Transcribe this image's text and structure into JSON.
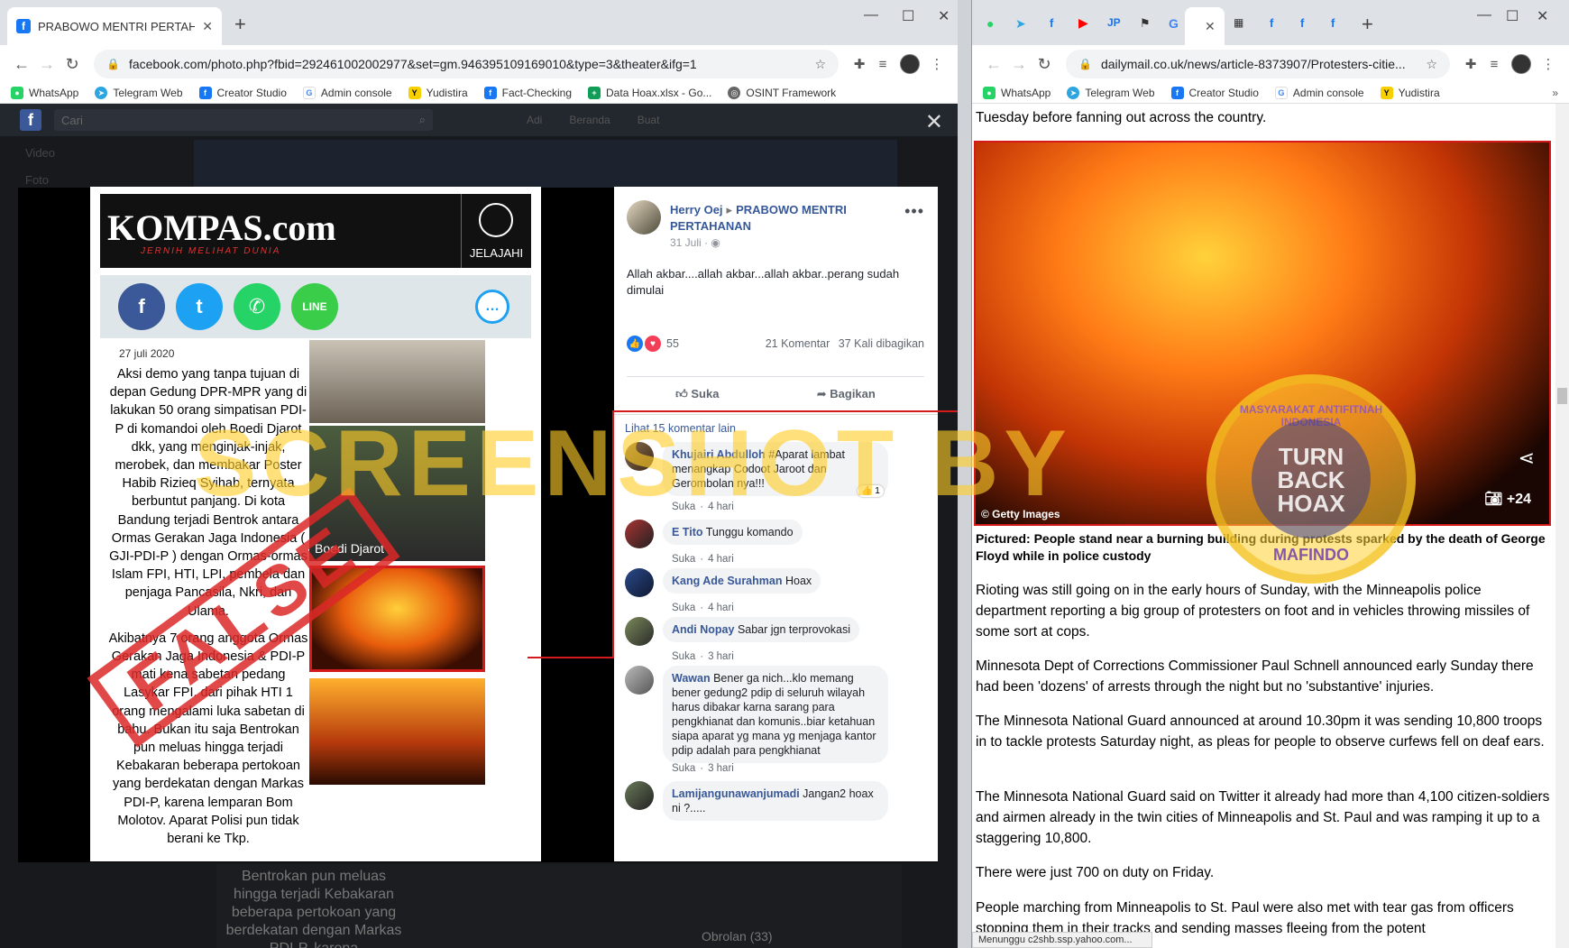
{
  "left": {
    "tab_title": "PRABOWO MENTRI PERTAHANAN",
    "url": "facebook.com/photo.php?fbid=292461002002977&set=gm.946395109169010&type=3&theater&ifg=1",
    "bookmarks": [
      "WhatsApp",
      "Telegram Web",
      "Creator Studio",
      "Admin console",
      "Yudistira",
      "Fact-Checking",
      "Data Hoax.xlsx - Go...",
      "OSINT Framework"
    ],
    "fb_search_placeholder": "Cari",
    "fb_header_links": [
      "Adi",
      "Beranda",
      "Buat"
    ],
    "fb_side": [
      "Video",
      "Foto"
    ],
    "article": {
      "brand": "KOMPAS.com",
      "tagline": "JERNIH MELIHAT DUNIA",
      "explore": "JELAJAHI",
      "date": "27 juli 2020",
      "body": "Aksi demo yang tanpa tujuan di depan Gedung DPR-MPR yang di lakukan 50 orang simpatisan PDI-P di komandoi oleh Boedi Djarot dkk, yang menginjak-injak, merobek, dan membakar Poster Habib Rizieq Syihab, ternyata berbuntut panjang. Di kota Bandung terjadi Bentrok antara Ormas Gerakan Jaga Indonesia ( GJI-PDI-P ) dengan Ormas-ormas Islam FPI, HTI, LPI, pembela dan penjaga Pancasila, Nkri, dan Ulama.",
      "body2": "Akibatnya 7 orang anggota Ormas Gerakan Jaga Indonesia & PDI-P mati kena sabetan pedang Lasykar FPI. dari pihak HTI 1 orang mengalami luka sabetan di bahu. Bukan itu saja Bentrokan pun meluas hingga terjadi Kebakaran beberapa pertokoan yang berdekatan dengan Markas PDI-P, karena lemparan Bom Molotov. Aparat Polisi pun tidak berani ke Tkp.",
      "photo_caption": "Boedi Djarot"
    },
    "stamp": "FALSE",
    "post": {
      "author": "Herry Oej",
      "group": "PRABOWO MENTRI PERTAHANAN",
      "date": "31 Juli",
      "text": "Allah akbar....allah akbar...allah akbar..perang sudah dimulai",
      "reactions": "55",
      "comment_count": "21 Komentar",
      "share_count": "37 Kali dibagikan",
      "like_label": "Suka",
      "share_label": "Bagikan",
      "more_comments": "Lihat 15 komentar lain"
    },
    "comments": [
      {
        "name": "Khujairi Abdulloh",
        "text": "#Aparat lambat menangkap Codoot Jaroot dan Gerombolan nya!!!",
        "like": "Suka",
        "time": "4 hari",
        "likes": "1"
      },
      {
        "name": "E Tito",
        "text": "Tunggu komando",
        "like": "Suka",
        "time": "4 hari"
      },
      {
        "name": "Kang Ade Surahman",
        "text": "Hoax",
        "like": "Suka",
        "time": "4 hari"
      },
      {
        "name": "Andi Nopay",
        "text": "Sabar jgn terprovokasi",
        "like": "Suka",
        "time": "3 hari"
      },
      {
        "name": "Wawan",
        "text": "Bener ga nich...klo memang bener gedung2 pdip di seluruh wilayah harus dibakar karna sarang para pengkhianat dan komunis..biar ketahuan siapa aparat yg mana yg menjaga kantor pdip adalah para pengkhianat",
        "like": "Suka",
        "time": "3 hari"
      },
      {
        "name": "Lamijangunawanjumadi",
        "text": "Jangan2 hoax ni ?.....",
        "like": "",
        "time": ""
      }
    ],
    "bottom_text": "Bentrokan pun meluas hingga terjadi Kebakaran beberapa pertokoan yang berdekatan dengan Markas PDI-P, karena",
    "bottom_label": "Obrolan (33)"
  },
  "right": {
    "url": "dailymail.co.uk/news/article-8373907/Protesters-citie...",
    "bookmarks": [
      "WhatsApp",
      "Telegram Web",
      "Creator Studio",
      "Admin console",
      "Yudistira"
    ],
    "top_text": "Tuesday before fanning out across the country.",
    "image_credit": "© Getty Images",
    "gallery": "+24",
    "caption": "Pictured: People stand near a burning building during protests sparked by the death of George Floyd while in police custody",
    "paragraphs": [
      "Rioting was still going on in the early hours of Sunday, with the Minneapolis police department reporting a big group of protesters on foot and in vehicles throwing missiles of some sort at cops.",
      "Minnesota Dept of Corrections Commissioner Paul Schnell announced early Sunday there had been 'dozens' of arrests through the night but no 'substantive' injuries.",
      "The Minnesota National Guard announced at around 10.30pm it was sending 10,800 troops in to tackle protests Saturday night, as pleas for people to observe curfews fell on deaf ears.",
      "The Minnesota National Guard said on Twitter it already had more than 4,100 citizen-soldiers and airmen already in the twin cities of Minneapolis and St. Paul and was ramping it up to a staggering 10,800.",
      "There were just 700 on duty on Friday.",
      "People marching from Minneapolis to St. Paul were also met with tear gas from officers stopping them in their tracks and sending masses fleeing from the potent"
    ],
    "status": "Menunggu c2shb.ssp.yahoo.com...",
    "logo_top": "MASYARAKAT ANTIFITNAH INDONESIA",
    "logo_center": "TURN BACK HOAX",
    "logo_bottom": "MAFINDO"
  },
  "watermark": "SCREENSHOT BY"
}
